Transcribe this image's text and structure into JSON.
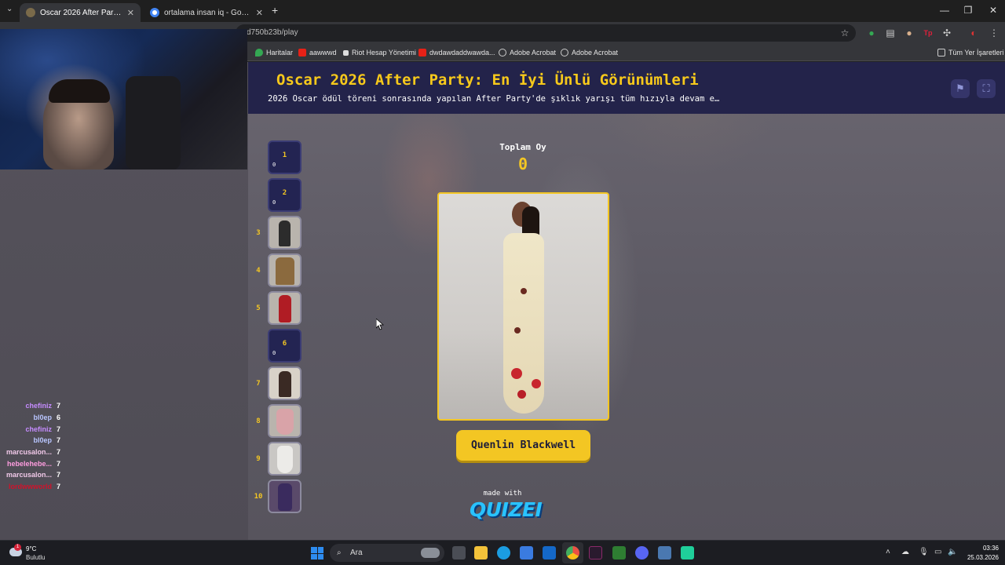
{
  "browser": {
    "tabs": [
      {
        "title": "Oscar 2026 After Party: En İyi Ü...",
        "active": true
      },
      {
        "title": "ortalama insan iq - Google'da A...",
        "active": false
      }
    ],
    "new_tab": "+",
    "address": "d750b23b/play",
    "bookmarks": [
      "Haritalar",
      "aawwwd",
      "Riot Hesap Yönetimi",
      "dwdawdaddwawda...",
      "Adobe Acrobat",
      "Adobe Acrobat"
    ],
    "all_bookmarks": "Tüm Yer İşaretleri",
    "window_controls": {
      "minimize": "—",
      "restore": "❐",
      "close": "✕"
    }
  },
  "quiz": {
    "title": "Oscar 2026 After Party: En İyi Ünlü Görünümleri",
    "subtitle": "2026 Oscar ödül töreni sonrasında yapılan After Party'de şıklık yarışı tüm hızıyla devam e…",
    "total_label": "Toplam Oy",
    "total_value": "0",
    "current_name": "Quenlin Blackwell",
    "made_with": "made with",
    "brand": "QUIZEI",
    "ranks": [
      {
        "num": "1",
        "votes": "0",
        "filled": false
      },
      {
        "num": "2",
        "votes": "0",
        "filled": false
      },
      {
        "num": "3",
        "filled": true,
        "color": "#2c2c2c"
      },
      {
        "num": "4",
        "filled": true,
        "color": "#8b6a3e"
      },
      {
        "num": "5",
        "filled": true,
        "color": "#b01c24"
      },
      {
        "num": "6",
        "votes": "0",
        "filled": false
      },
      {
        "num": "7",
        "filled": true,
        "color": "#3a2a24"
      },
      {
        "num": "8",
        "filled": true,
        "color": "#d9a3a8"
      },
      {
        "num": "9",
        "filled": true,
        "color": "#ecebe8"
      },
      {
        "num": "10",
        "filled": true,
        "color": "#3a2b5e"
      }
    ]
  },
  "chat": [
    {
      "name": "chefiniz",
      "value": "7",
      "color": "#c58cff"
    },
    {
      "name": "bl0ep",
      "value": "6",
      "color": "#b9c6ff"
    },
    {
      "name": "chefiniz",
      "value": "7",
      "color": "#c58cff"
    },
    {
      "name": "bl0ep",
      "value": "7",
      "color": "#b9c6ff"
    },
    {
      "name": "marcusalon...",
      "value": "7",
      "color": "#f0c8e8"
    },
    {
      "name": "hebelehebe...",
      "value": "7",
      "color": "#ff9de0"
    },
    {
      "name": "marcusalon...",
      "value": "7",
      "color": "#f0c8e8"
    },
    {
      "name": "lordwwworld",
      "value": "7",
      "color": "#d0122b"
    }
  ],
  "taskbar": {
    "temp": "9°C",
    "weather": "Bulutlu",
    "search": "Ara",
    "time": "03:36",
    "date": "25.03.2026",
    "notification_badge": "1"
  }
}
